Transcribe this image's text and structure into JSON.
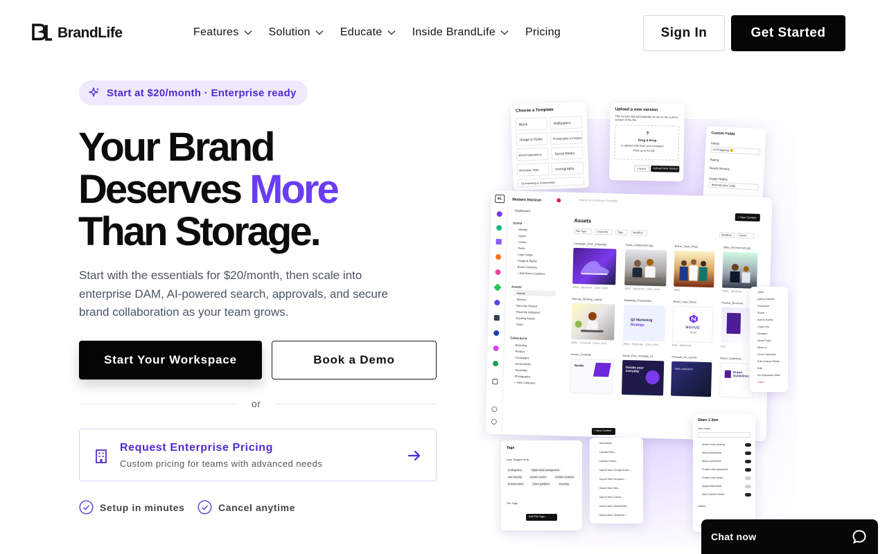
{
  "brand": {
    "name": "BrandLife",
    "logo_mark": "BL",
    "accent_color": "#6a3df5",
    "dark_color": "#050505"
  },
  "nav": {
    "items": [
      {
        "label": "Features",
        "has_dropdown": true
      },
      {
        "label": "Solution",
        "has_dropdown": true
      },
      {
        "label": "Educate",
        "has_dropdown": true
      },
      {
        "label": "Inside BrandLife",
        "has_dropdown": true
      },
      {
        "label": "Pricing",
        "has_dropdown": false
      }
    ],
    "sign_in": "Sign In",
    "get_started": "Get Started"
  },
  "hero": {
    "pill": "Start at $20/month · Enterprise ready",
    "headline_line1": "Your Brand",
    "headline_line2_start": "Deserves ",
    "headline_line2_accent": "More",
    "headline_line3": "Than Storage.",
    "subtext": "Start with the essentials for $20/month, then scale into enterprise DAM, AI-powered search, approvals, and secure brand collaboration as your team grows.",
    "primary_cta": "Start Your Workspace",
    "secondary_cta": "Book a Demo",
    "or": "or",
    "enterprise_title": "Request Enterprise Pricing",
    "enterprise_sub": "Custom pricing for teams with advanced needs",
    "features": [
      "Setup in minutes",
      "Cancel anytime"
    ]
  },
  "mockup": {
    "template": {
      "title": "Choose a Template",
      "options": [
        "Blank",
        "Wallpapers",
        "Usage & Rules",
        "Photography & Imagery",
        "Brand Applications",
        "Social Media",
        "Illustration Style",
        "Iconography",
        "Co-branding & Partnerships"
      ]
    },
    "upload": {
      "title": "Upload a new version",
      "note": "This version will automatically be set as the current version of the file.",
      "drop": "Drag & Drop",
      "select": "or upload a file from your computer",
      "limit": "Files up to 10 GB",
      "cancel": "Cancel",
      "confirm": "Upload New Version"
    },
    "custom_fields": {
      "title": "Custom Fields",
      "status_label": "Status",
      "status_value": "In Progress 🙂",
      "rating_label": "Rating",
      "review_label": "Needs Review",
      "usage_label": "Usage Rights",
      "usage_value": "Internal Use Only"
    },
    "app": {
      "workspace": "Modern Horizon",
      "search_placeholder": "Search for anything in Brandlife",
      "new_content": "+ New Content",
      "dashboard": "Dashboard",
      "brand_section": "Brand",
      "brand_items": [
        "Identity",
        "Logos",
        "Colors",
        "Fonts",
        "Logo Usage",
        "Usage & Rights",
        "Brand Overview",
        "+ Add Brand Guideline"
      ],
      "assets_section": "Assets",
      "asset_items": [
        "Assets",
        "Starred",
        "Recently Viewed",
        "Recently Uploaded",
        "Expiring Assets",
        "Trash"
      ],
      "collections_section": "Collections",
      "collection_items": [
        "Branding",
        "Product",
        "Campaigns",
        "Social Media",
        "Templates",
        "Photography",
        "+ New Collection"
      ],
      "page_title": "Assets",
      "filters": [
        "File Type",
        "Channels",
        "Tags",
        "Modified"
      ],
      "sort": "Modified",
      "view": "Name",
      "asset_labels": [
        "Campaign_Shoe_Image.jpg",
        "Team_Collaboration.jpg",
        "Brand_Team_Photo",
        "Office_Environment.jpg",
        "Remote_Working_Laptop",
        "Marketing_Presentation",
        "Brand_Logo_Novus",
        "Product_Brochure",
        "Invoice_Template",
        "Social_Post_Template_01",
        "Postcard_for_Launch",
        "Brand_Guidelines"
      ],
      "asset_meta": [
        "JPEG · 150.00 KB · 1234 x 1024",
        "JPEG · 150.00 KB · 1234 x 1024",
        "JPEG",
        "JPEG · 100.00 KB",
        "JPEG · 175.00 KB · 1234 x 1024",
        "JPEG · 250.00 KB · 1234 x 1024",
        "PNG · 180.00 KB",
        "PDF"
      ],
      "q2_title": "Q2 Marketing",
      "q2_sub": "Strategy",
      "novus": "NOVUS",
      "novus_sub": "TECH",
      "bundle_title": "Bundle",
      "decide_text": "Decide your everyday",
      "new_collection": "New collection",
      "guidelines": "Brand Guidelines"
    },
    "context_menu": [
      "Open",
      "Add to Starred",
      "Download",
      "Share",
      "Add to Board",
      "Copy Link",
      "Rename",
      "Move/Copy",
      "Move to",
      "Go to Collection",
      "Edit Custom Fields",
      "Edit",
      "Set Expiration Date",
      "Trash"
    ],
    "add_menu": {
      "button": "+ New Content",
      "items": [
        "Add Asset...",
        "Upload Files...",
        "Upload Folder...",
        "Import from Google Drive...",
        "Import from Dropbox...",
        "Import from Box...",
        "Import from Canva...",
        "Import from SharePoint...",
        "Import from OneDrive..."
      ]
    },
    "tags": {
      "title": "Tags",
      "ai_label": "Auto Tagged by AI",
      "chips": [
        "ai integration",
        "digital asset management",
        "user security",
        "version control",
        "creative workflow",
        "ai brand asset",
        "brand guideline",
        "branding"
      ],
      "file_tags": "File Tags",
      "add_button": "Add File Tags..."
    },
    "share": {
      "title": "Share 1 item",
      "link_label": "Link name",
      "options": [
        "Show cross-sharing",
        "Allow downloads",
        "Allow comments",
        "Protect with password",
        "Protect with email",
        "Apply watermark",
        "Add Custom Fields"
      ],
      "options_on": [
        true,
        true,
        true,
        true,
        false,
        false,
        true
      ],
      "status": "Status"
    }
  },
  "chat": {
    "label": "Chat now"
  }
}
